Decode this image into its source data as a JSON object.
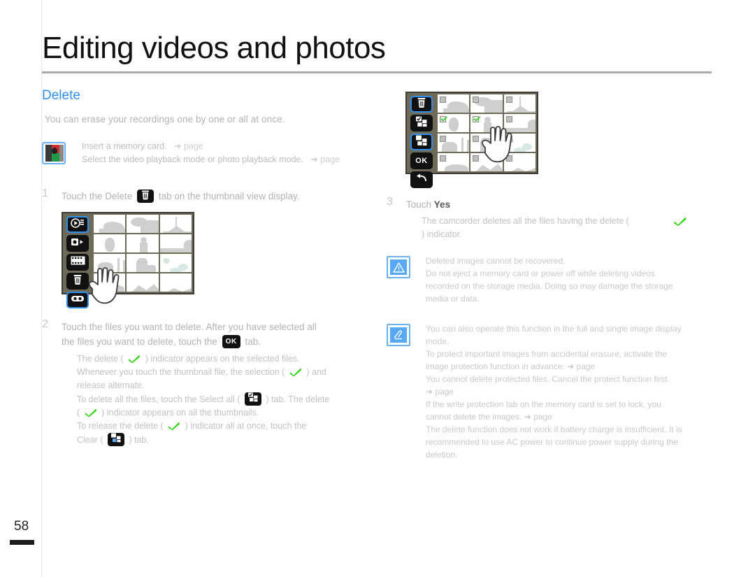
{
  "header": {
    "chapter_title": "Editing videos and photos",
    "section_title": "Delete",
    "intro": "You can erase your recordings one by one or all at once."
  },
  "prerequisites": {
    "icon": "memory-card-icon",
    "lines": [
      {
        "text": "Insert a memory card.",
        "ref": "➜ page"
      },
      {
        "text": "Select the video playback mode or photo playback mode.",
        "ref": "➜ page"
      }
    ]
  },
  "steps": [
    {
      "number": "1",
      "text_before": "Touch the Delete",
      "chip": "trash-icon",
      "text_after": "tab on the thumbnail view display."
    },
    {
      "number": "2",
      "line1": "Touch the files you want to delete. After you have selected all",
      "line2_before": "the files you want to delete, touch the",
      "chip_ok": "OK",
      "line2_after": "tab.",
      "notes": [
        {
          "a": "The delete (",
          "icon": "check-icon",
          "b": ") indicator appears on the selected files."
        },
        {
          "a": "Whenever you touch the thumbnail file, the selection (",
          "icon": "check-icon",
          "b": ") and"
        },
        {
          "a": "release alternate.",
          "icon": "",
          "b": ""
        },
        {
          "a": "To delete all the files, touch the Select all (",
          "icon": "select-all-icon",
          "b": ") tab. The delete"
        },
        {
          "a": "(",
          "icon": "check-icon",
          "b": ") indicator appears on all the thumbnails."
        },
        {
          "a": "To release the delete (",
          "icon": "check-icon",
          "b": ") indicator all at once, touch the"
        },
        {
          "a": "Clear (",
          "icon": "clear-icon",
          "b": ") tab."
        }
      ]
    },
    {
      "number": "3",
      "text_before": "Touch",
      "bold": "Yes",
      "sub_line1": "The camcorder deletes all the files having the delete (",
      "sub_icon": "check-icon",
      "sub_line2": ") indicator."
    }
  ],
  "lcd_left": {
    "name": "thumbnail-view-display-1",
    "tabs": [
      {
        "id": "video-play-icon",
        "label": "",
        "selected": true
      },
      {
        "id": "photo-play-icon",
        "label": "",
        "selected": false
      },
      {
        "id": "film-strip-icon",
        "label": "",
        "selected": false
      },
      {
        "id": "trash-icon",
        "label": "",
        "selected": false
      },
      {
        "id": "share-icon",
        "label": "",
        "selected": true
      }
    ],
    "checkboxes_visible": false,
    "pointer": "hand-cursor"
  },
  "lcd_right": {
    "name": "thumbnail-view-display-2",
    "tabs": [
      {
        "id": "trash-icon",
        "label": "",
        "selected": true
      },
      {
        "id": "select-all-icon",
        "label": "",
        "selected": false
      },
      {
        "id": "clear-icon",
        "label": "",
        "selected": true
      },
      {
        "id": "ok-tab",
        "label": "OK",
        "selected": false
      },
      {
        "id": "back-arrow-icon",
        "label": "",
        "selected": false
      }
    ],
    "checkboxes_visible": true,
    "checked_cells": [
      3,
      4
    ],
    "pointer": "hand-cursor"
  },
  "warning": {
    "icon": "warning-triangle-icon",
    "lines": [
      "Deleted images cannot be recovered.",
      "Do not eject a memory card or power off while deleting videos",
      "recorded on the storage media. Doing so may damage the storage",
      "media or data."
    ]
  },
  "note": {
    "icon": "note-hand-icon",
    "lines": [
      "You can also operate this function in the full and single image display",
      "mode.",
      "To protect important images from accidental erasure, activate the",
      "image protection function in advance. ➜ page",
      "You cannot delete protected files. Cancel the protect function first.",
      "➜ page",
      "If the write protection tab on the memory card is set to lock, you",
      "cannot delete the images. ➜ page",
      "The delete function does not work if battery charge is insufficient. It is",
      "recommended to use AC power to continue power supply during the",
      "deletion."
    ]
  },
  "footer": {
    "page_number": "58"
  },
  "colors": {
    "accent_blue": "#2f8ff0",
    "check_green": "#2bd40f",
    "text_gray": "#b3b3b3",
    "lcd_frame": "#6d6a58"
  }
}
